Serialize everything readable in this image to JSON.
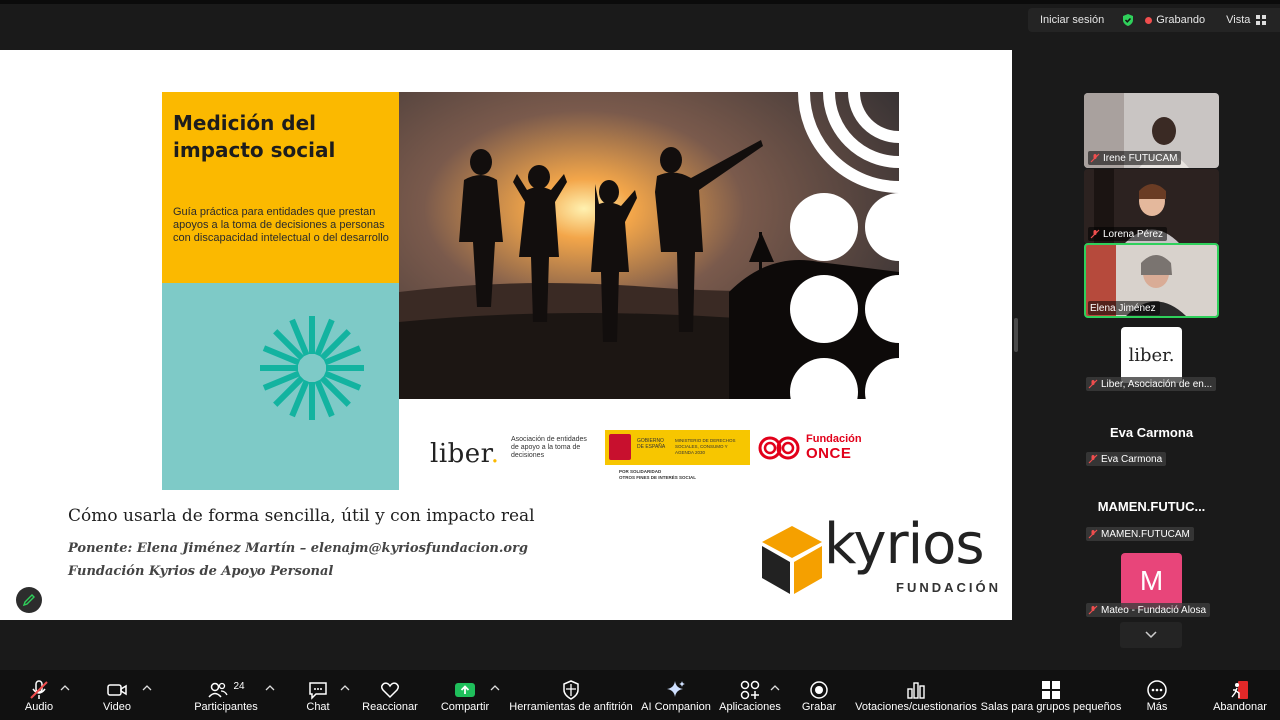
{
  "topbar": {
    "signin": "Iniciar sesión",
    "recording": "Grabando",
    "view": "Vista",
    "colors": {
      "recording_dot": "#f04e4e",
      "security_shield": "#2fd05b"
    }
  },
  "slide": {
    "cover": {
      "title": "Medición del impacto social",
      "subtitle": "Guía práctica para entidades que prestan apoyos a la toma de decisiones a personas con discapacidad intelectual o del desarrollo",
      "colors": {
        "yellow": "#fbb900",
        "teal": "#7ecac7",
        "burst": "#13b3a0"
      },
      "logos": {
        "liber": "liber",
        "liber_desc": "Asociación de entidades de apoyo a la toma de decisiones",
        "gov_line1": "GOBIERNO DE ESPAÑA",
        "gov_line2": "MINISTERIO DE DERECHOS SOCIALES, CONSUMO Y AGENDA 2030",
        "gov_sub1": "POR SOLIDARIDAD",
        "gov_sub2": "OTROS FINES DE INTERÉS SOCIAL",
        "once_line1": "Fundación",
        "once_line2": "ONCE"
      }
    },
    "headline": "Cómo usarla de forma sencilla, útil y con impacto real",
    "ponente": "Ponente: Elena Jiménez Martín – elenajm@kyriosfundacion.org",
    "fundacion": "Fundación Kyrios de Apoyo Personal",
    "kyrios_logo": {
      "word": "kyrios",
      "sub": "FUNDACIÓN"
    }
  },
  "gallery": {
    "participants": [
      {
        "name": "Irene FUTUCAM",
        "muted": true
      },
      {
        "name": "Lorena Pérez",
        "muted": true
      },
      {
        "name": "Elena Jiménez",
        "muted": false,
        "active_speaker": true
      },
      {
        "name": "Liber, Asociación de en...",
        "muted": true,
        "avatar_text": "liber."
      },
      {
        "name": "Eva Carmona",
        "display": "Eva Carmona",
        "muted": true
      },
      {
        "name": "MAMEN.FUTUCAM",
        "display": "MAMEN.FUTUC...",
        "muted": true
      },
      {
        "name": "Mateo - Fundació Alosa",
        "muted": true,
        "avatar_letter": "M",
        "avatar_color": "#e8457a"
      }
    ]
  },
  "toolbar": {
    "audio": "Audio",
    "video": "Video",
    "participants": "Participantes",
    "participants_count": "24",
    "chat": "Chat",
    "react": "Reaccionar",
    "share": "Compartir",
    "host_tools": "Herramientas de anfitrión",
    "ai_companion": "AI Companion",
    "apps": "Aplicaciones",
    "record": "Grabar",
    "polls": "Votaciones/cuestionarios",
    "breakout": "Salas para grupos pequeños",
    "more": "Más",
    "leave": "Abandonar",
    "colors": {
      "share_green": "#1fbf5b",
      "leave_red": "#e02828"
    }
  }
}
